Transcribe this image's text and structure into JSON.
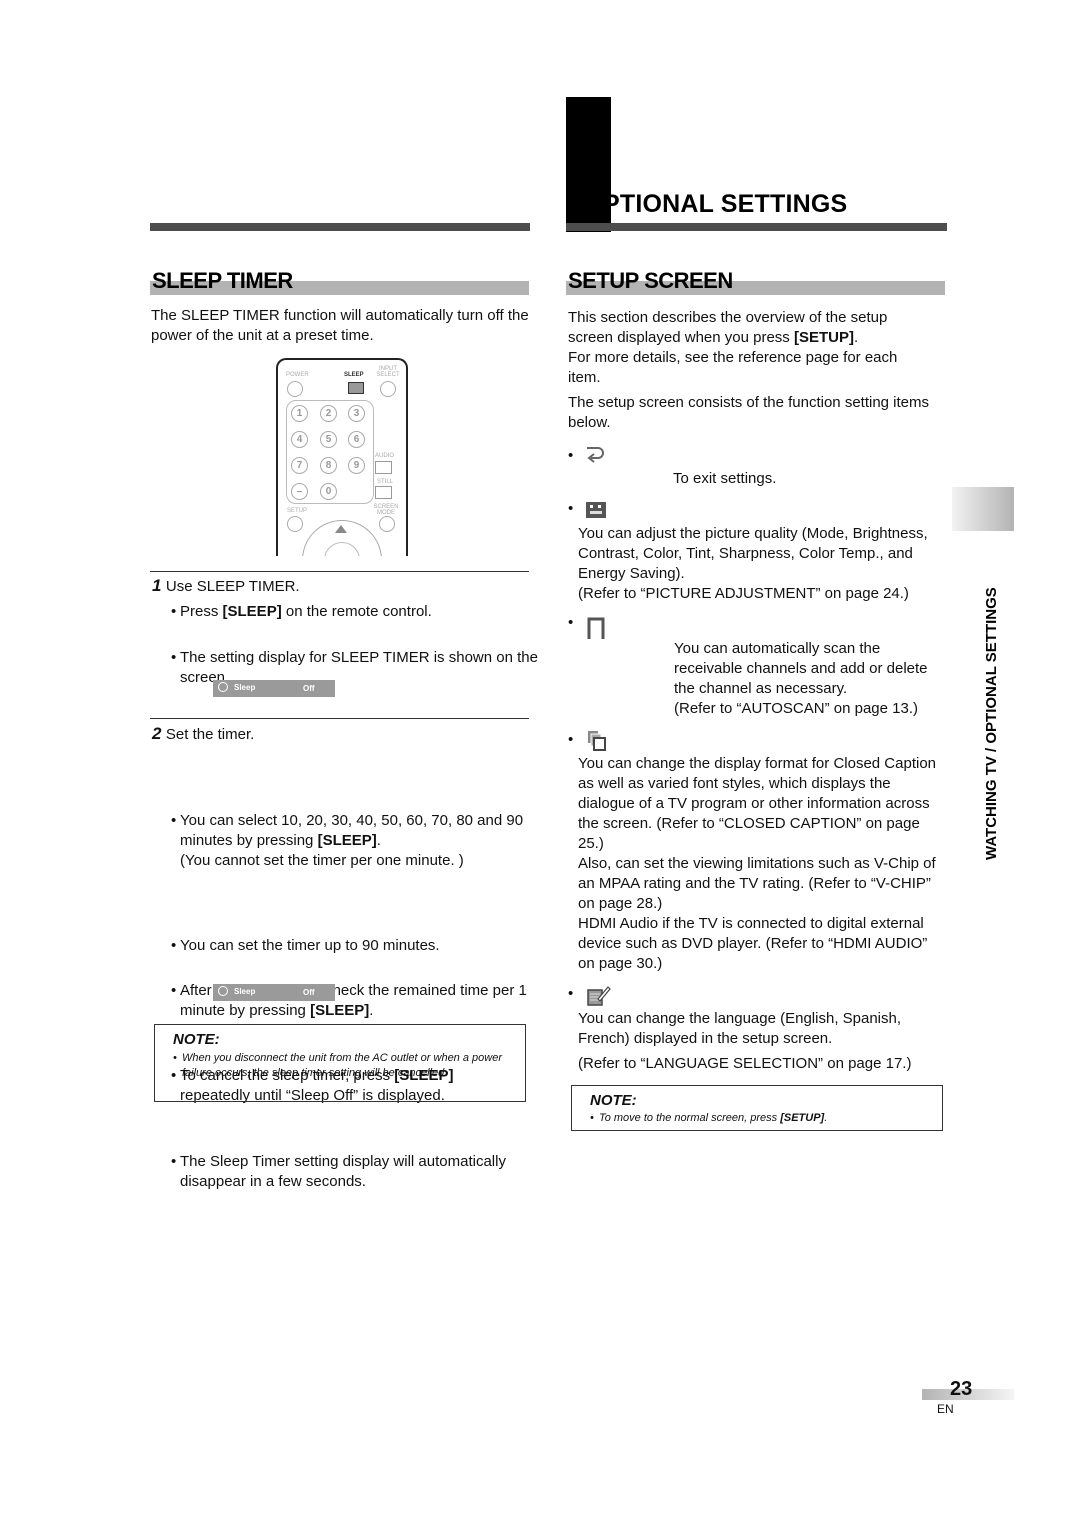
{
  "chapter": {
    "title": "PTIONAL SETTINGS"
  },
  "sleep_timer": {
    "heading": "SLEEP TIMER",
    "intro": "The SLEEP TIMER function will automatically turn off the power of the unit at a preset time.",
    "remote": {
      "labels": {
        "power": "POWER",
        "sleep": "SLEEP",
        "input_select": "INPUT SELECT",
        "audio": "AUDIO",
        "still": "STILL",
        "setup": "SETUP",
        "screen_mode": "SCREEN MODE"
      },
      "keys": [
        "1",
        "2",
        "3",
        "4",
        "5",
        "6",
        "7",
        "8",
        "9",
        "–",
        "0"
      ]
    },
    "step1": {
      "number": "1",
      "title": "Use SLEEP TIMER.",
      "bullets": [
        {
          "pre": "Press ",
          "bold": "[SLEEP]",
          "post": " on the remote control."
        },
        {
          "pre": "The setting display for SLEEP TIMER is shown on the screen.",
          "bold": "",
          "post": ""
        }
      ]
    },
    "osd1": {
      "label": "Sleep",
      "value": "Off"
    },
    "step2": {
      "number": "2",
      "title": "Set the timer.",
      "bullets": [
        {
          "pre": "You can select 10, 20, 30, 40, 50, 60, 70, 80 and 90 minutes by pressing ",
          "bold": "[SLEEP]",
          "post": ".",
          "extra": "(You cannot set the timer per one minute. )"
        },
        {
          "pre": "You can set the timer up to 90 minutes.",
          "bold": "",
          "post": ""
        },
        {
          "pre": "After setting, you can check the remained time per 1 minute by pressing ",
          "bold": "[SLEEP]",
          "post": "."
        },
        {
          "pre": "To cancel the sleep timer, press ",
          "bold": "[SLEEP]",
          "post": " repeatedly until “Sleep Off” is displayed."
        },
        {
          "pre": "The Sleep Timer setting display will automatically disappear in a few seconds.",
          "bold": "",
          "post": ""
        }
      ]
    },
    "osd2": {
      "label": "Sleep",
      "value": "Off"
    },
    "note": {
      "title": "NOTE:",
      "text": "When you disconnect the unit from the AC outlet or when a power failure occurs, the sleep timer setting will be cancelled."
    }
  },
  "setup_screen": {
    "heading": "SETUP SCREEN",
    "intro1_pre": "This section describes the overview of the setup screen displayed when you press ",
    "intro1_bold": "[SETUP]",
    "intro1_post": ".",
    "intro2": "For more details, see the reference page for each item.",
    "intro3": "The setup screen consists of the function setting items below.",
    "items": [
      {
        "icon": "return-icon",
        "text": "To exit settings."
      },
      {
        "icon": "picture-icon",
        "text": "You can adjust the picture quality (Mode, Brightness, Contrast, Color, Tint, Sharpness, Color Temp., and Energy Saving).",
        "ref": "(Refer to “PICTURE ADJUSTMENT” on page 24.)"
      },
      {
        "icon": "channel-icon",
        "text": "You can automatically scan the receivable channels and add or delete the channel as necessary.",
        "ref": "(Refer to “AUTOSCAN” on page 13.)"
      },
      {
        "icon": "detail-icon",
        "text": "You can change the display format for Closed Caption as well as varied font styles, which displays the dialogue of a TV program or other information across the screen. (Refer to “CLOSED CAPTION” on page 25.)",
        "text2": "Also, can set the viewing limitations such as V-Chip of an MPAA rating and the TV rating. (Refer to “V-CHIP” on page 28.)",
        "text3": "HDMI Audio if the TV is connected to digital external device such as DVD player. (Refer to “HDMI AUDIO” on page 30.)"
      },
      {
        "icon": "language-icon",
        "text": "You can change the language (English, Spanish, French) displayed in the setup screen.",
        "ref": "(Refer to “LANGUAGE SELECTION” on page 17.)"
      }
    ],
    "note": {
      "title": "NOTE:",
      "pre": "To move to the normal screen, press ",
      "bold": "[SETUP]",
      "post": "."
    }
  },
  "side_tab": {
    "label": "WATCHING TV / OPTIONAL SETTINGS"
  },
  "footer": {
    "page": "23",
    "lang": "EN"
  }
}
